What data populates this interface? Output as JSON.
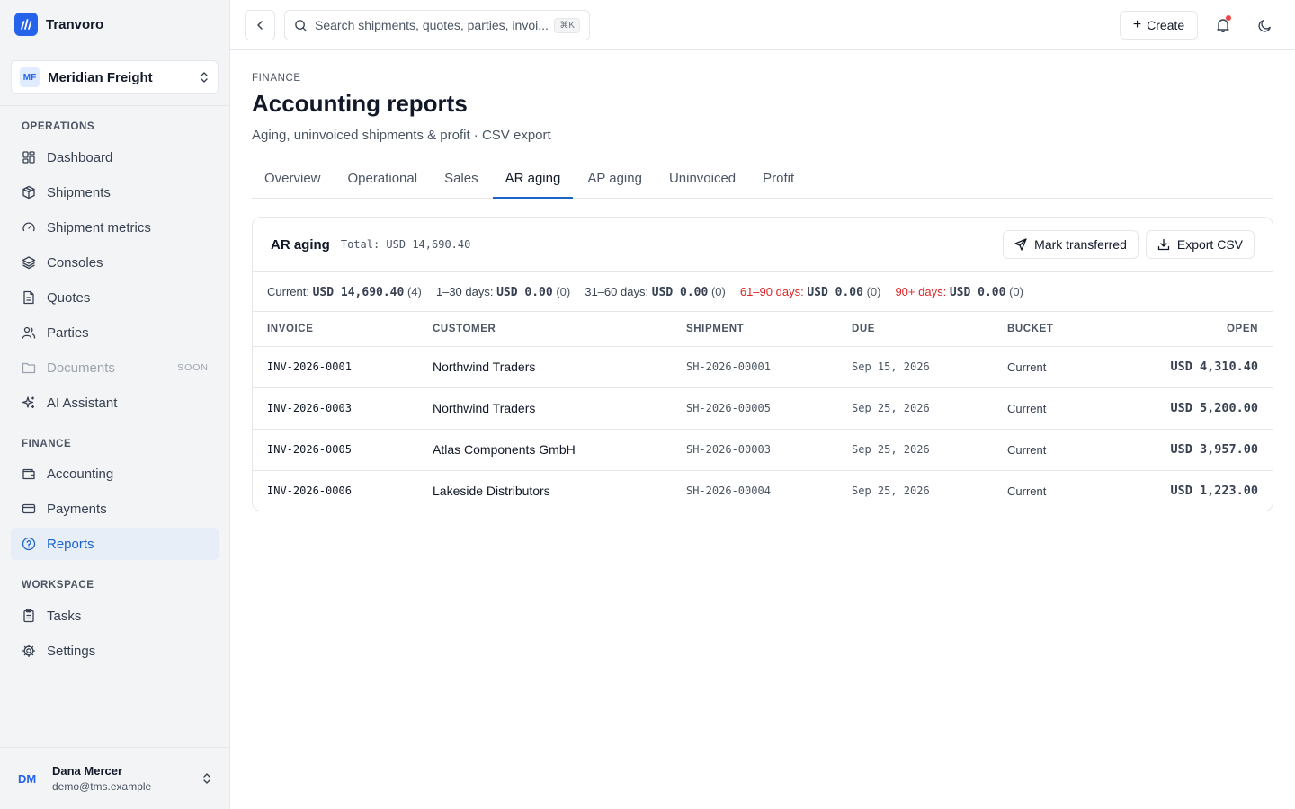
{
  "brand": {
    "name": "Tranvoro"
  },
  "org": {
    "initials": "MF",
    "name": "Meridian Freight"
  },
  "sidebar": {
    "sections": [
      {
        "label": "OPERATIONS"
      },
      {
        "label": "FINANCE"
      },
      {
        "label": "WORKSPACE"
      }
    ],
    "items": [
      {
        "label": "Dashboard",
        "icon": "dashboard-icon"
      },
      {
        "label": "Shipments",
        "icon": "package-icon"
      },
      {
        "label": "Shipment metrics",
        "icon": "gauge-icon"
      },
      {
        "label": "Consoles",
        "icon": "layers-icon"
      },
      {
        "label": "Quotes",
        "icon": "file-text-icon"
      },
      {
        "label": "Parties",
        "icon": "users-icon"
      },
      {
        "label": "Documents",
        "icon": "folder-icon",
        "badge": "SOON"
      },
      {
        "label": "AI Assistant",
        "icon": "sparkles-icon"
      },
      {
        "label": "Accounting",
        "icon": "wallet-icon"
      },
      {
        "label": "Payments",
        "icon": "credit-card-icon"
      },
      {
        "label": "Reports",
        "icon": "help-circle-icon",
        "active": true
      },
      {
        "label": "Tasks",
        "icon": "clipboard-icon"
      },
      {
        "label": "Settings",
        "icon": "gear-icon"
      }
    ]
  },
  "user": {
    "initials": "DM",
    "name": "Dana Mercer",
    "email": "demo@tms.example"
  },
  "topbar": {
    "search_placeholder": "Search shipments, quotes, parties, invoi...",
    "search_shortcut": "⌘K",
    "create_label": "Create",
    "notification_dot_color": "#ef4444"
  },
  "page": {
    "eyebrow": "FINANCE",
    "title": "Accounting reports",
    "subtitle": "Aging, uninvoiced shipments & profit · CSV export"
  },
  "tabs": [
    {
      "label": "Overview"
    },
    {
      "label": "Operational"
    },
    {
      "label": "Sales"
    },
    {
      "label": "AR aging",
      "active": true
    },
    {
      "label": "AP aging"
    },
    {
      "label": "Uninvoiced"
    },
    {
      "label": "Profit"
    }
  ],
  "report": {
    "title": "AR aging",
    "total": "Total: USD 14,690.40",
    "mark_transferred_label": "Mark transferred",
    "export_label": "Export CSV",
    "buckets": [
      {
        "label": "Current:",
        "amount": "USD 14,690.40",
        "count": "(4)"
      },
      {
        "label": "1–30 days:",
        "amount": "USD 0.00",
        "count": "(0)"
      },
      {
        "label": "31–60 days:",
        "amount": "USD 0.00",
        "count": "(0)"
      },
      {
        "label": "61–90 days:",
        "amount": "USD 0.00",
        "count": "(0)",
        "warn": true
      },
      {
        "label": "90+ days:",
        "amount": "USD 0.00",
        "count": "(0)",
        "warn": true
      }
    ],
    "columns": [
      "INVOICE",
      "CUSTOMER",
      "SHIPMENT",
      "DUE",
      "BUCKET",
      "OPEN"
    ],
    "rows": [
      {
        "invoice": "INV-2026-0001",
        "customer": "Northwind Traders",
        "shipment": "SH-2026-00001",
        "due": "Sep 15, 2026",
        "bucket": "Current",
        "open": "USD 4,310.40"
      },
      {
        "invoice": "INV-2026-0003",
        "customer": "Northwind Traders",
        "shipment": "SH-2026-00005",
        "due": "Sep 25, 2026",
        "bucket": "Current",
        "open": "USD 5,200.00"
      },
      {
        "invoice": "INV-2026-0005",
        "customer": "Atlas Components GmbH",
        "shipment": "SH-2026-00003",
        "due": "Sep 25, 2026",
        "bucket": "Current",
        "open": "USD 3,957.00"
      },
      {
        "invoice": "INV-2026-0006",
        "customer": "Lakeside Distributors",
        "shipment": "SH-2026-00004",
        "due": "Sep 25, 2026",
        "bucket": "Current",
        "open": "USD 1,223.00"
      }
    ]
  },
  "colors": {
    "accent": "#2563eb",
    "active_text": "#1d64c8",
    "warn": "#dc2626"
  }
}
